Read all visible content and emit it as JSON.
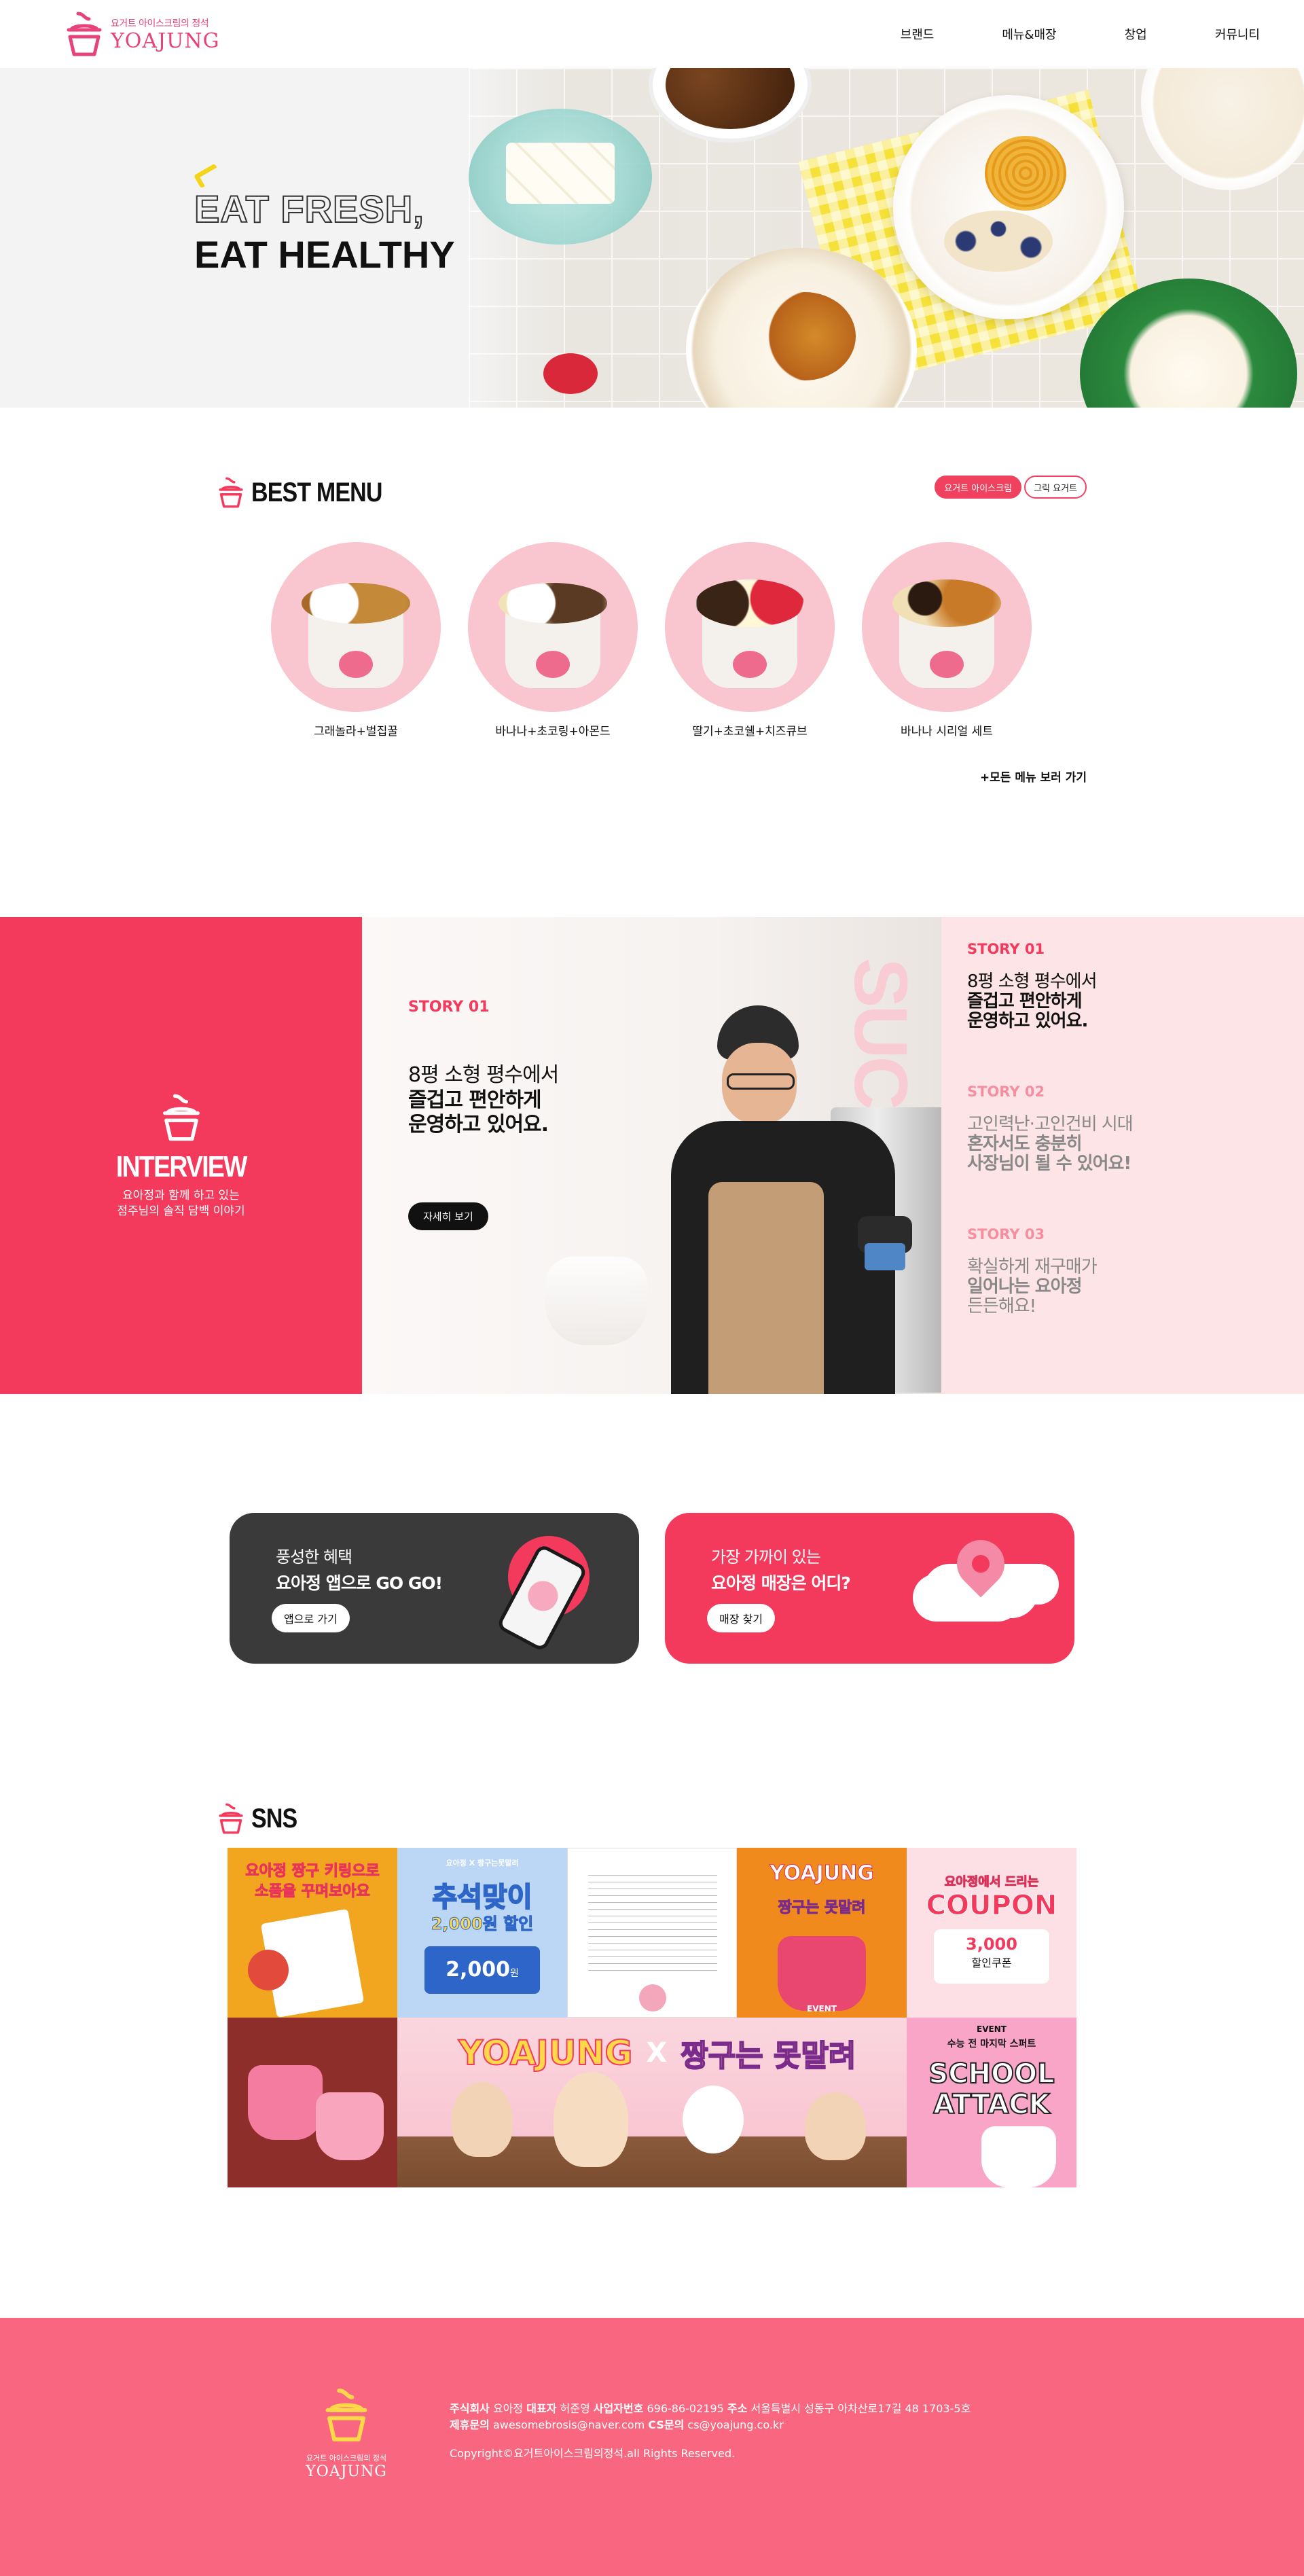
{
  "brand": {
    "tagline": "요거트 아이스크림의 정석",
    "name": "YOAJUNG"
  },
  "nav": {
    "items": [
      "브랜드",
      "메뉴&매장",
      "창업",
      "커뮤니티"
    ]
  },
  "hero": {
    "line1": "EAT FRESH,",
    "line2": "EAT HEALTHY"
  },
  "best_menu": {
    "title": "BEST MENU",
    "tabs": [
      "요거트 아이스크림",
      "그릭 요거트"
    ],
    "items": [
      {
        "name": "그래놀라+벌집꿀"
      },
      {
        "name": "바나나+초코링+아몬드"
      },
      {
        "name": "딸기+초코쉘+치즈큐브"
      },
      {
        "name": "바나나 시리얼 세트"
      }
    ],
    "see_all": "+모든 메뉴 보러 가기"
  },
  "interview": {
    "title": "INTERVIEW",
    "subtitle_line1": "요아정과 함께 하고 있는",
    "subtitle_line2": "점주님의 솔직 담백 이야기",
    "main_label": "STORY 01",
    "main_line1": "8평 소형 평수에서",
    "main_line2": "즐겁고 편안하게",
    "main_line3": "운영하고 있어요.",
    "button": "자세히 보기",
    "bg_text": "SUCC",
    "stories": [
      {
        "label": "STORY 01",
        "line1": "8평 소형 평수에서",
        "line2": "즐겁고 편안하게",
        "line3": "운영하고 있어요."
      },
      {
        "label": "STORY 02",
        "line1": "고인력난·고인건비 시대",
        "line2": "혼자서도 충분히",
        "line3": "사장님이 될 수 있어요!"
      },
      {
        "label": "STORY 03",
        "line1": "확실하게 재구매가",
        "line2": "일어나는 요아정",
        "line3": "든든해요!"
      }
    ]
  },
  "cta": {
    "app": {
      "sub": "풍성한 혜택",
      "main": "요아정 앱으로 GO GO!",
      "button": "앱으로 가기"
    },
    "store": {
      "sub": "가장 가까이 있는",
      "main": "요아정 매장은 어디?",
      "button": "매장 찾기"
    }
  },
  "sns": {
    "title": "SNS",
    "tiles": {
      "t1_line1": "요아정 짱구 키링으로",
      "t1_line2": "소품을 꾸며보아요",
      "t2_badge": "요아정 X 짱구는못말려",
      "t2_title": "추석맞이",
      "t2_sub": "2,000원 할인",
      "t2_coupon": "2,000",
      "t2_coupon_unit": "원",
      "t4_logo": "YOAJUNG",
      "t4_sub": "짱구는 못말려",
      "t4_event": "EVENT",
      "t5_top": "요아정에서 드리는",
      "t5_title": "COUPON",
      "t5_amount": "3,000",
      "t5_sub": "할인쿠폰",
      "t7_logo": "YOAJUNG",
      "t7_x": "X",
      "t7_sub": "짱구는 못말려",
      "t8_badge": "EVENT",
      "t8_top": "수능 전 마지막 스퍼트",
      "t8_title1": "SCHOOL",
      "t8_title2": "ATTACK"
    }
  },
  "footer": {
    "tagline": "요거트 아이스크림의 정석",
    "name": "YOAJUNG",
    "company_label": "주식회사",
    "company": "요아정",
    "ceo_label": "대표자",
    "ceo": "허준영",
    "biz_label": "사업자번호",
    "biz": "696-86-02195",
    "addr_label": "주소",
    "addr": "서울특별시 성동구 아차산로17길 48 1703-5호",
    "partner_label": "제휴문의",
    "partner": "awesomebrosis@naver.com",
    "cs_label": "CS문의",
    "cs": "cs@yoajung.co.kr",
    "copyright": "Copyright©요거트아이스크림의정석.all Rights Reserved."
  },
  "colors": {
    "accent": "#f33a5c",
    "accent_soft": "#fde5e7",
    "footer": "#f8677f",
    "dark": "#3a3a3a",
    "menu_circle": "#f9c5cf"
  }
}
